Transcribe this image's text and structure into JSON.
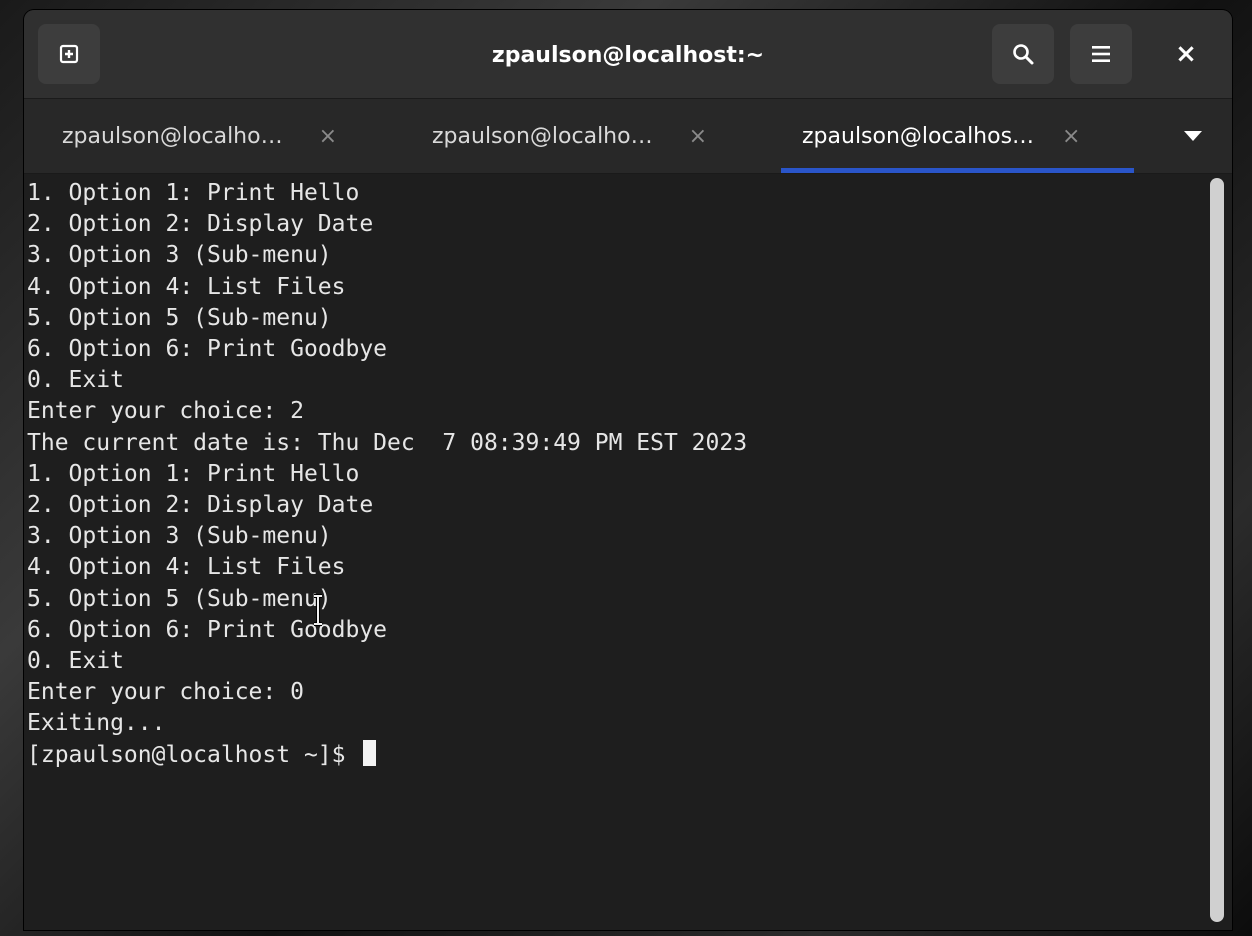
{
  "window": {
    "title": "zpaulson@localhost:~"
  },
  "headerbar": {
    "new_tab_icon": "new-tab-icon",
    "search_icon": "search-icon",
    "menu_icon": "hamburger-menu-icon",
    "close_glyph": "×"
  },
  "tabs": [
    {
      "label": "zpaulson@localho…",
      "active": false
    },
    {
      "label": "zpaulson@localho…",
      "active": false
    },
    {
      "label": "zpaulson@localhos…",
      "active": true
    }
  ],
  "tab_close_glyph": "×",
  "terminal": {
    "lines": [
      "1. Option 1: Print Hello",
      "2. Option 2: Display Date",
      "3. Option 3 (Sub-menu)",
      "4. Option 4: List Files",
      "5. Option 5 (Sub-menu)",
      "6. Option 6: Print Goodbye",
      "0. Exit",
      "Enter your choice: 2",
      "The current date is: Thu Dec  7 08:39:49 PM EST 2023",
      "1. Option 1: Print Hello",
      "2. Option 2: Display Date",
      "3. Option 3 (Sub-menu)",
      "4. Option 4: List Files",
      "5. Option 5 (Sub-menu)",
      "6. Option 6: Print Goodbye",
      "0. Exit",
      "Enter your choice: 0",
      "Exiting..."
    ],
    "prompt": "[zpaulson@localhost ~]$ "
  },
  "colors": {
    "accent": "#2a55c9",
    "headerbar": "#303030",
    "terminal_bg": "#1e1e1e",
    "terminal_fg": "#e6e6e6"
  }
}
